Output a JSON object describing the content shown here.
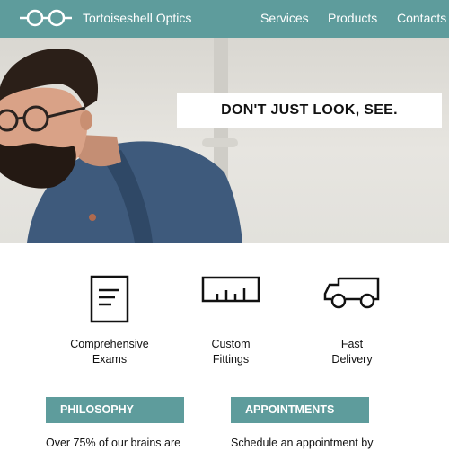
{
  "header": {
    "brand": "Tortoiseshell Optics",
    "logo_icon": "eyeglasses-icon",
    "nav": [
      "Services",
      "Products",
      "Contacts"
    ],
    "background": "#5e9c9c"
  },
  "hero": {
    "banner": "DON'T JUST LOOK, SEE.",
    "image": "man-with-glasses-photo"
  },
  "features": [
    {
      "icon": "document-icon",
      "label": "Comprehensive\nExams"
    },
    {
      "icon": "ruler-icon",
      "label": "Custom\nFittings"
    },
    {
      "icon": "truck-icon",
      "label": "Fast\nDelivery"
    }
  ],
  "sections": {
    "philosophy": {
      "title": "PHILOSOPHY",
      "text": "Over 75% of our brains are"
    },
    "appointments": {
      "title": "APPOINTMENTS",
      "text": "Schedule an appointment by"
    }
  },
  "colors": {
    "accent": "#5e9c9c",
    "text": "#111111"
  }
}
